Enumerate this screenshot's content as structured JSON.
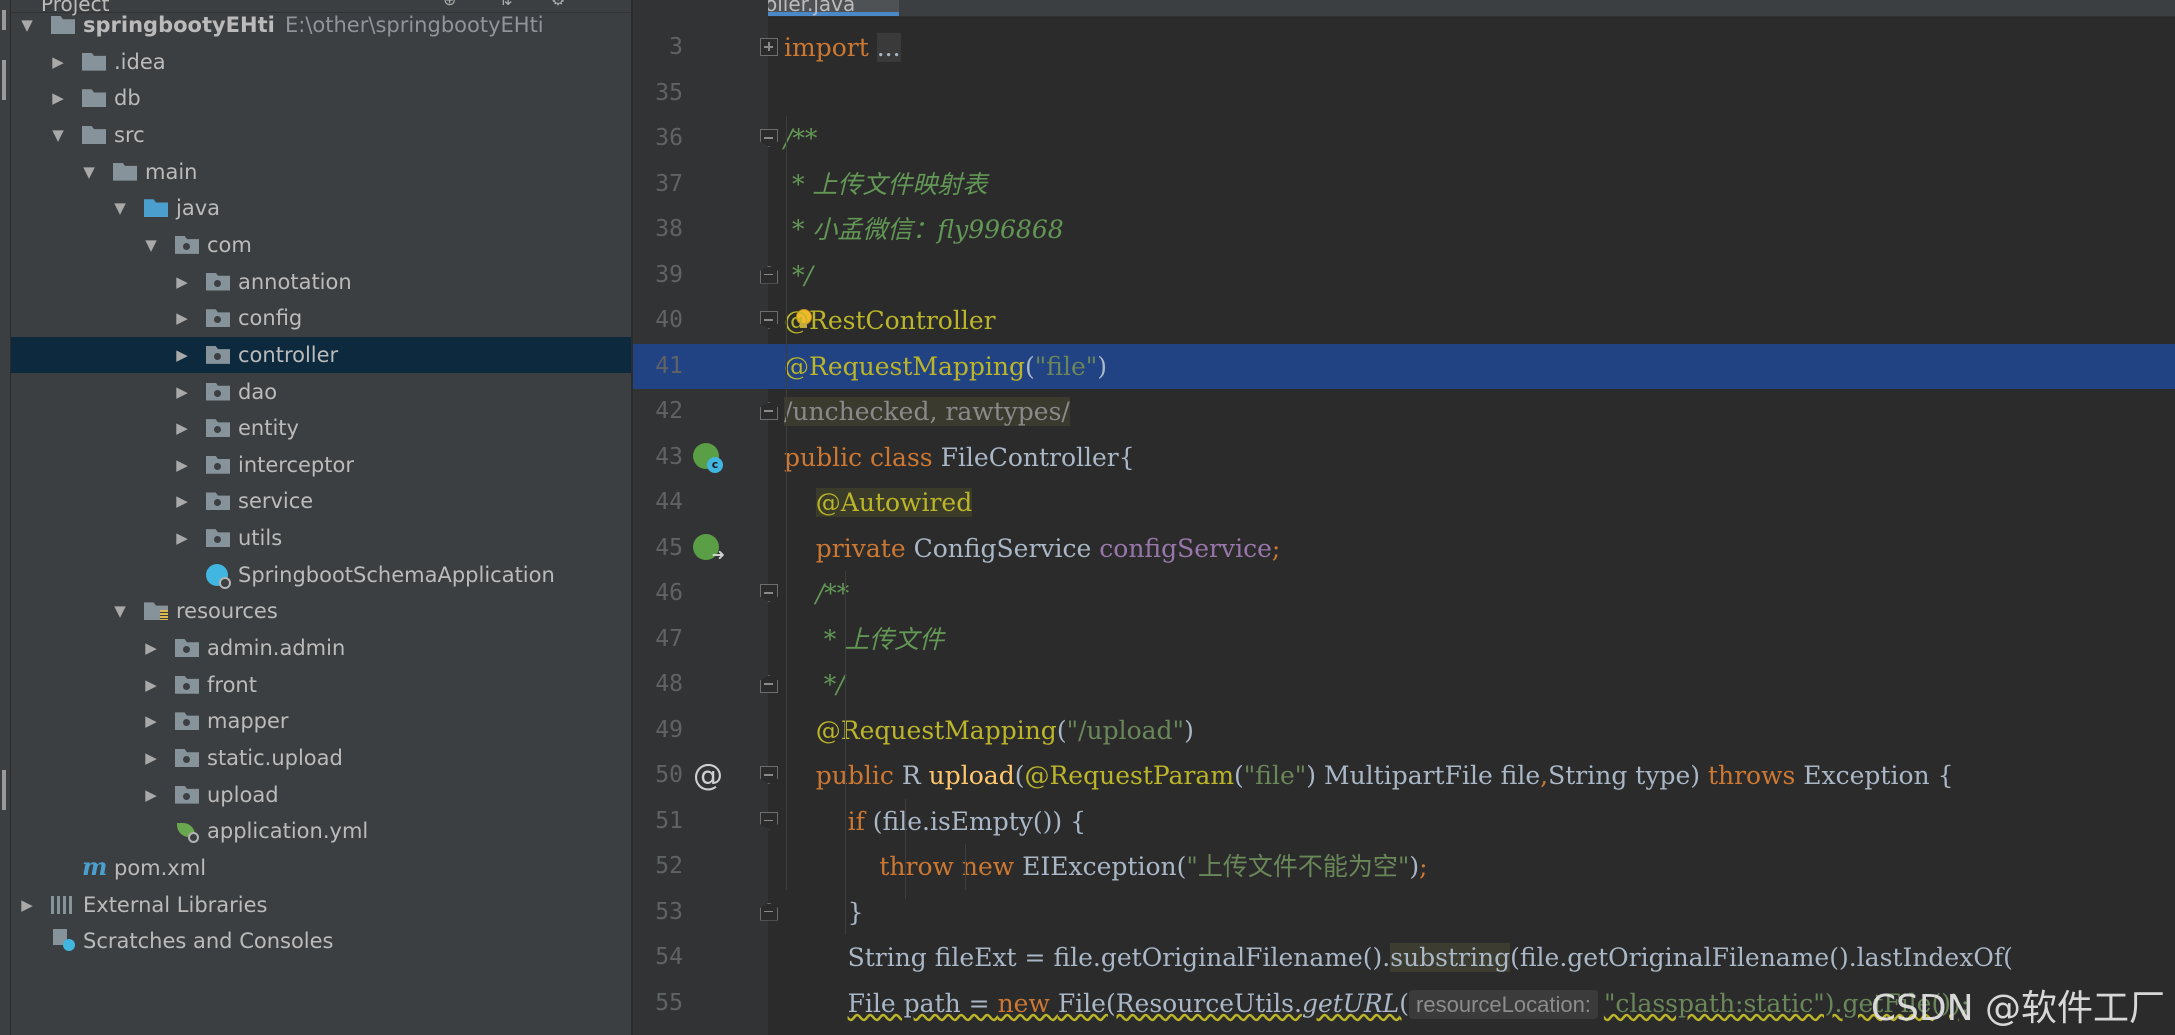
{
  "project_panel": {
    "header_title": "Project",
    "tree": [
      {
        "label": "springbootyEHti",
        "path": "E:\\other\\springbootyEHti",
        "depth": 0,
        "arrow": "down",
        "icon": "module-folder"
      },
      {
        "label": ".idea",
        "depth": 1,
        "arrow": "right",
        "icon": "folder"
      },
      {
        "label": "db",
        "depth": 1,
        "arrow": "right",
        "icon": "folder"
      },
      {
        "label": "src",
        "depth": 1,
        "arrow": "down",
        "icon": "folder"
      },
      {
        "label": "main",
        "depth": 2,
        "arrow": "down",
        "icon": "folder"
      },
      {
        "label": "java",
        "depth": 3,
        "arrow": "down",
        "icon": "source-folder"
      },
      {
        "label": "com",
        "depth": 4,
        "arrow": "down",
        "icon": "package"
      },
      {
        "label": "annotation",
        "depth": 5,
        "arrow": "right",
        "icon": "package"
      },
      {
        "label": "config",
        "depth": 5,
        "arrow": "right",
        "icon": "package"
      },
      {
        "label": "controller",
        "depth": 5,
        "arrow": "right",
        "icon": "package",
        "selected": true
      },
      {
        "label": "dao",
        "depth": 5,
        "arrow": "right",
        "icon": "package"
      },
      {
        "label": "entity",
        "depth": 5,
        "arrow": "right",
        "icon": "package"
      },
      {
        "label": "interceptor",
        "depth": 5,
        "arrow": "right",
        "icon": "package"
      },
      {
        "label": "service",
        "depth": 5,
        "arrow": "right",
        "icon": "package"
      },
      {
        "label": "utils",
        "depth": 5,
        "arrow": "right",
        "icon": "package"
      },
      {
        "label": "SpringbootSchemaApplication",
        "depth": 5,
        "arrow": "none",
        "icon": "spring-class"
      },
      {
        "label": "resources",
        "depth": 3,
        "arrow": "down",
        "icon": "resources-folder"
      },
      {
        "label": "admin.admin",
        "depth": 4,
        "arrow": "right",
        "icon": "package"
      },
      {
        "label": "front",
        "depth": 4,
        "arrow": "right",
        "icon": "package"
      },
      {
        "label": "mapper",
        "depth": 4,
        "arrow": "right",
        "icon": "package"
      },
      {
        "label": "static.upload",
        "depth": 4,
        "arrow": "right",
        "icon": "package"
      },
      {
        "label": "upload",
        "depth": 4,
        "arrow": "right",
        "icon": "package"
      },
      {
        "label": "application.yml",
        "depth": 4,
        "arrow": "none",
        "icon": "spring-yml"
      },
      {
        "label": "pom.xml",
        "depth": 1,
        "arrow": "none",
        "icon": "maven"
      },
      {
        "label": "External Libraries",
        "depth": 0,
        "arrow": "right",
        "icon": "libraries"
      },
      {
        "label": "Scratches and Consoles",
        "depth": 0,
        "arrow": "none",
        "icon": "scratches"
      }
    ]
  },
  "editor": {
    "tab_label": "FileController.java",
    "hint_label": "resourceLocation:",
    "lines": [
      {
        "n": "3",
        "fold": "plus",
        "parts": [
          {
            "t": "import ",
            "c": "kw"
          },
          {
            "t": "...",
            "c": "fold-box"
          }
        ]
      },
      {
        "n": "35",
        "parts": []
      },
      {
        "n": "36",
        "fold": "open",
        "parts": [
          {
            "t": "/**",
            "c": "doc"
          }
        ]
      },
      {
        "n": "37",
        "parts": [
          {
            "t": " * 上传文件映射表",
            "c": "doc"
          }
        ]
      },
      {
        "n": "38",
        "parts": [
          {
            "t": " * 小孟微信：fly996868",
            "c": "doc"
          }
        ]
      },
      {
        "n": "39",
        "fold": "close",
        "parts": [
          {
            "t": " */",
            "c": "doc"
          }
        ]
      },
      {
        "n": "40",
        "fold": "open",
        "bulb": true,
        "parts": [
          {
            "t": "@RestController",
            "c": "ann"
          }
        ]
      },
      {
        "n": "41",
        "hl": true,
        "parts": [
          {
            "t": "@RequestMapping",
            "c": "ann"
          },
          {
            "t": "(",
            "c": "plain"
          },
          {
            "t": "\"file\"",
            "c": "str"
          },
          {
            "t": ")",
            "c": "plain"
          }
        ]
      },
      {
        "n": "42",
        "fold": "close",
        "parts": [
          {
            "t": "/unchecked, rawtypes/",
            "c": "inspect"
          }
        ]
      },
      {
        "n": "43",
        "gicon": "spring-c",
        "parts": [
          {
            "t": "public class ",
            "c": "kw"
          },
          {
            "t": "FileController{",
            "c": "plain"
          }
        ]
      },
      {
        "n": "44",
        "parts": [
          {
            "t": "    ",
            "c": "plain"
          },
          {
            "t": "@Autowired",
            "c": "ann autow"
          }
        ]
      },
      {
        "n": "45",
        "gicon": "spring-arrow",
        "parts": [
          {
            "t": "    ",
            "c": "plain"
          },
          {
            "t": "private ",
            "c": "kw"
          },
          {
            "t": "ConfigService ",
            "c": "plain"
          },
          {
            "t": "configService",
            "c": "fld"
          },
          {
            "t": ";",
            "c": "kw"
          }
        ]
      },
      {
        "n": "46",
        "fold": "open",
        "parts": [
          {
            "t": "    /**",
            "c": "doc"
          }
        ]
      },
      {
        "n": "47",
        "parts": [
          {
            "t": "     * 上传文件",
            "c": "doc"
          }
        ]
      },
      {
        "n": "48",
        "fold": "close",
        "parts": [
          {
            "t": "     */",
            "c": "doc"
          }
        ]
      },
      {
        "n": "49",
        "parts": [
          {
            "t": "    ",
            "c": "plain"
          },
          {
            "t": "@RequestMapping",
            "c": "ann"
          },
          {
            "t": "(",
            "c": "plain"
          },
          {
            "t": "\"/upload\"",
            "c": "str"
          },
          {
            "t": ")",
            "c": "plain"
          }
        ]
      },
      {
        "n": "50",
        "fold": "open",
        "gicon": "at",
        "parts": [
          {
            "t": "    ",
            "c": "plain"
          },
          {
            "t": "public ",
            "c": "kw"
          },
          {
            "t": "R ",
            "c": "plain"
          },
          {
            "t": "upload",
            "c": "fn"
          },
          {
            "t": "(",
            "c": "plain"
          },
          {
            "t": "@RequestParam",
            "c": "ann"
          },
          {
            "t": "(",
            "c": "plain"
          },
          {
            "t": "\"file\"",
            "c": "str"
          },
          {
            "t": ") MultipartFile file",
            "c": "plain"
          },
          {
            "t": ",",
            "c": "kw"
          },
          {
            "t": "String type) ",
            "c": "plain"
          },
          {
            "t": "throws ",
            "c": "kw"
          },
          {
            "t": "Exception {",
            "c": "plain"
          }
        ]
      },
      {
        "n": "51",
        "fold": "open",
        "parts": [
          {
            "t": "        ",
            "c": "plain"
          },
          {
            "t": "if ",
            "c": "kw"
          },
          {
            "t": "(file.isEmpty()) {",
            "c": "plain"
          }
        ]
      },
      {
        "n": "52",
        "parts": [
          {
            "t": "            ",
            "c": "plain"
          },
          {
            "t": "throw new ",
            "c": "kw"
          },
          {
            "t": "EIException(",
            "c": "plain"
          },
          {
            "t": "\"上传文件不能为空\"",
            "c": "str"
          },
          {
            "t": ")",
            "c": "plain"
          },
          {
            "t": ";",
            "c": "kw"
          }
        ]
      },
      {
        "n": "53",
        "fold": "close",
        "parts": [
          {
            "t": "        }",
            "c": "plain"
          }
        ]
      },
      {
        "n": "54",
        "parts": [
          {
            "t": "        String fileExt = file.getOriginalFilename().",
            "c": "plain"
          },
          {
            "t": "substring",
            "c": "plain substr-hl"
          },
          {
            "t": "(file.getOriginalFilename().lastIndexOf(",
            "c": "plain"
          }
        ]
      },
      {
        "n": "55",
        "hint": true,
        "parts": [
          {
            "t": "        ",
            "c": "plain"
          },
          {
            "t": "File path = ",
            "c": "plain warn-ul"
          },
          {
            "t": "new ",
            "c": "kw warn-ul"
          },
          {
            "t": "File(ResourceUtils.",
            "c": "plain warn-ul"
          },
          {
            "t": "getURL",
            "c": "plain ital warn-ul"
          },
          {
            "t": "(",
            "c": "plain warn-ul"
          },
          {
            "t": "HINT",
            "c": "hint"
          },
          {
            "t": "\"classpath:static\").getFile());",
            "c": "str warn-ul"
          }
        ]
      }
    ]
  },
  "watermark": "CSDN @软件工厂"
}
